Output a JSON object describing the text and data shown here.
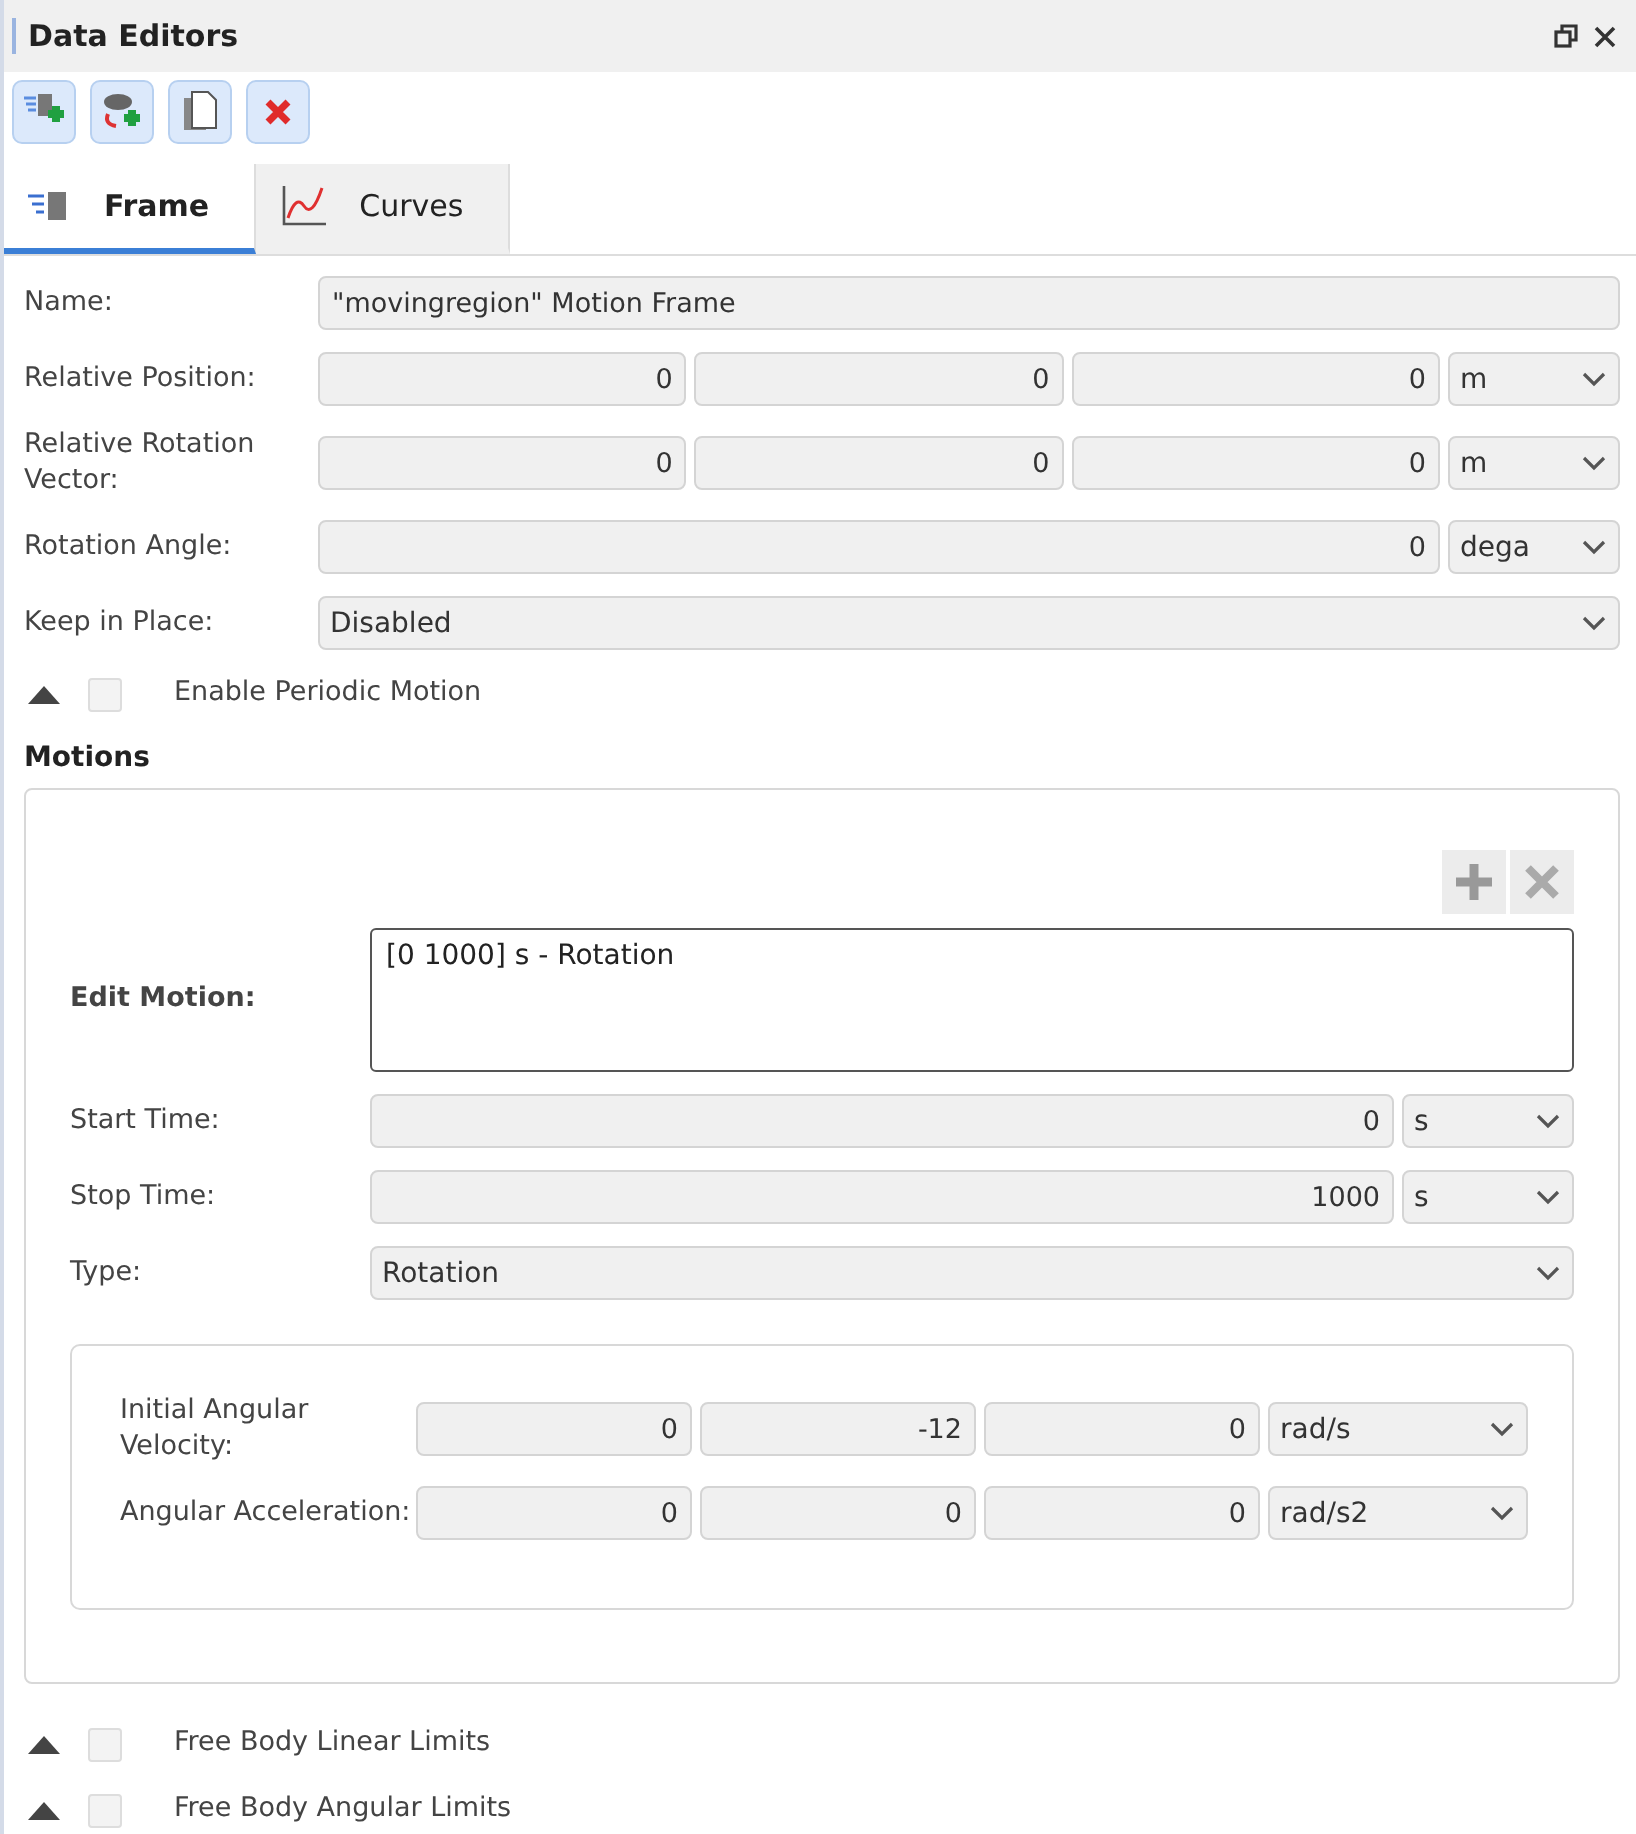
{
  "window": {
    "title": "Data Editors"
  },
  "toolbar": [
    {
      "kind": "add-frame"
    },
    {
      "kind": "add-cloud"
    },
    {
      "kind": "copy"
    },
    {
      "kind": "delete"
    }
  ],
  "tabs": [
    {
      "label": "Frame",
      "kind": "frame",
      "selected": true
    },
    {
      "label": "Curves",
      "kind": "curves",
      "selected": false
    }
  ],
  "frame_fields": [
    {
      "label": "Name:",
      "kind": "text",
      "value": "\"movingregion\" Motion Frame"
    },
    {
      "label": "Relative Position:",
      "kind": "vector",
      "values": [
        "0",
        "0",
        "0"
      ],
      "unit": "m"
    },
    {
      "label": "Relative Rotation Vector:",
      "kind": "vector",
      "values": [
        "0",
        "0",
        "0"
      ],
      "unit": "m"
    },
    {
      "label": "Rotation Angle:",
      "kind": "scalar",
      "value": "0",
      "unit": "dega"
    },
    {
      "label": "Keep in Place:",
      "kind": "select",
      "value": "Disabled"
    }
  ],
  "periodic": {
    "label": "Enable Periodic Motion",
    "checked": false
  },
  "motions": {
    "title": "Motions",
    "edit_label": "Edit Motion:",
    "items": [
      "[0 1000] s - Rotation"
    ],
    "fields": [
      {
        "label": "Start Time:",
        "kind": "scalar",
        "value": "0",
        "unit": "s"
      },
      {
        "label": "Stop Time:",
        "kind": "scalar",
        "value": "1000",
        "unit": "s"
      },
      {
        "label": "Type:",
        "kind": "select",
        "value": "Rotation"
      }
    ],
    "subfields": [
      {
        "label": "Initial Angular Velocity:",
        "values": [
          "0",
          "-12",
          "0"
        ],
        "unit": "rad/s"
      },
      {
        "label": "Angular Acceleration:",
        "values": [
          "0",
          "0",
          "0"
        ],
        "unit": "rad/s2"
      }
    ]
  },
  "bottom_options": [
    {
      "label": "Free Body Linear Limits",
      "checked": false
    },
    {
      "label": "Free Body Angular Limits",
      "checked": false
    }
  ]
}
